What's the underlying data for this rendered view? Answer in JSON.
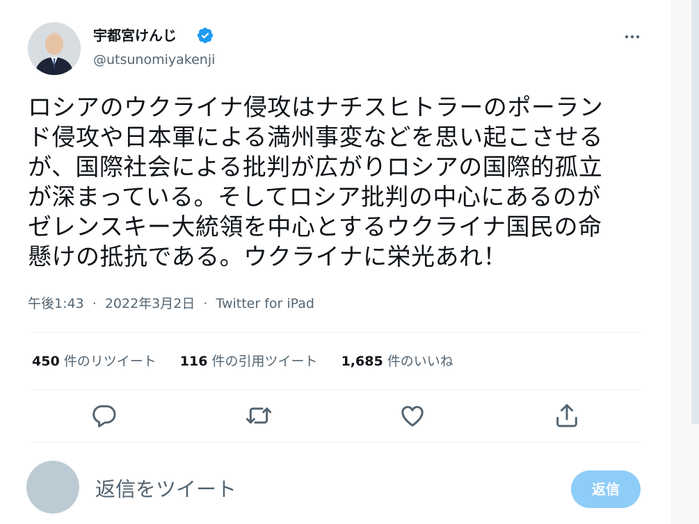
{
  "author": {
    "display_name": "宇都宮けんじ",
    "username": "@utsunomiyakenji",
    "verified": true
  },
  "tweet": {
    "lines": [
      "ロシアのウクライナ侵攻はナチスヒトラーのポーラン",
      "ド侵攻や日本軍による満州事変などを思い起こさせる",
      "が、国際社会による批判が広がりロシアの国際的孤立",
      "が深まっている。そしてロシア批判の中心にあるのが",
      "ゼレンスキー大統領を中心とするウクライナ国民の命",
      "懸けの抵抗である。ウクライナに栄光あれ！"
    ],
    "time": "午後1:43",
    "date": "2022年3月2日",
    "source": "Twitter for iPad",
    "separator": "·"
  },
  "stats": {
    "retweets_count": "450",
    "retweets_label": "件のリツイート",
    "quotes_count": "116",
    "quotes_label": "件の引用ツイート",
    "likes_count": "1,685",
    "likes_label": "件のいいね"
  },
  "actions": {
    "icons": [
      "reply-icon",
      "retweet-icon",
      "like-icon",
      "share-icon"
    ]
  },
  "reply": {
    "placeholder": "返信をツイート",
    "button_label": "返信"
  },
  "colors": {
    "text": "#0f1419",
    "secondary": "#536471",
    "accent": "#1d9bf0",
    "reply_button": "#8ecdf8",
    "divider": "#eff3f4"
  }
}
